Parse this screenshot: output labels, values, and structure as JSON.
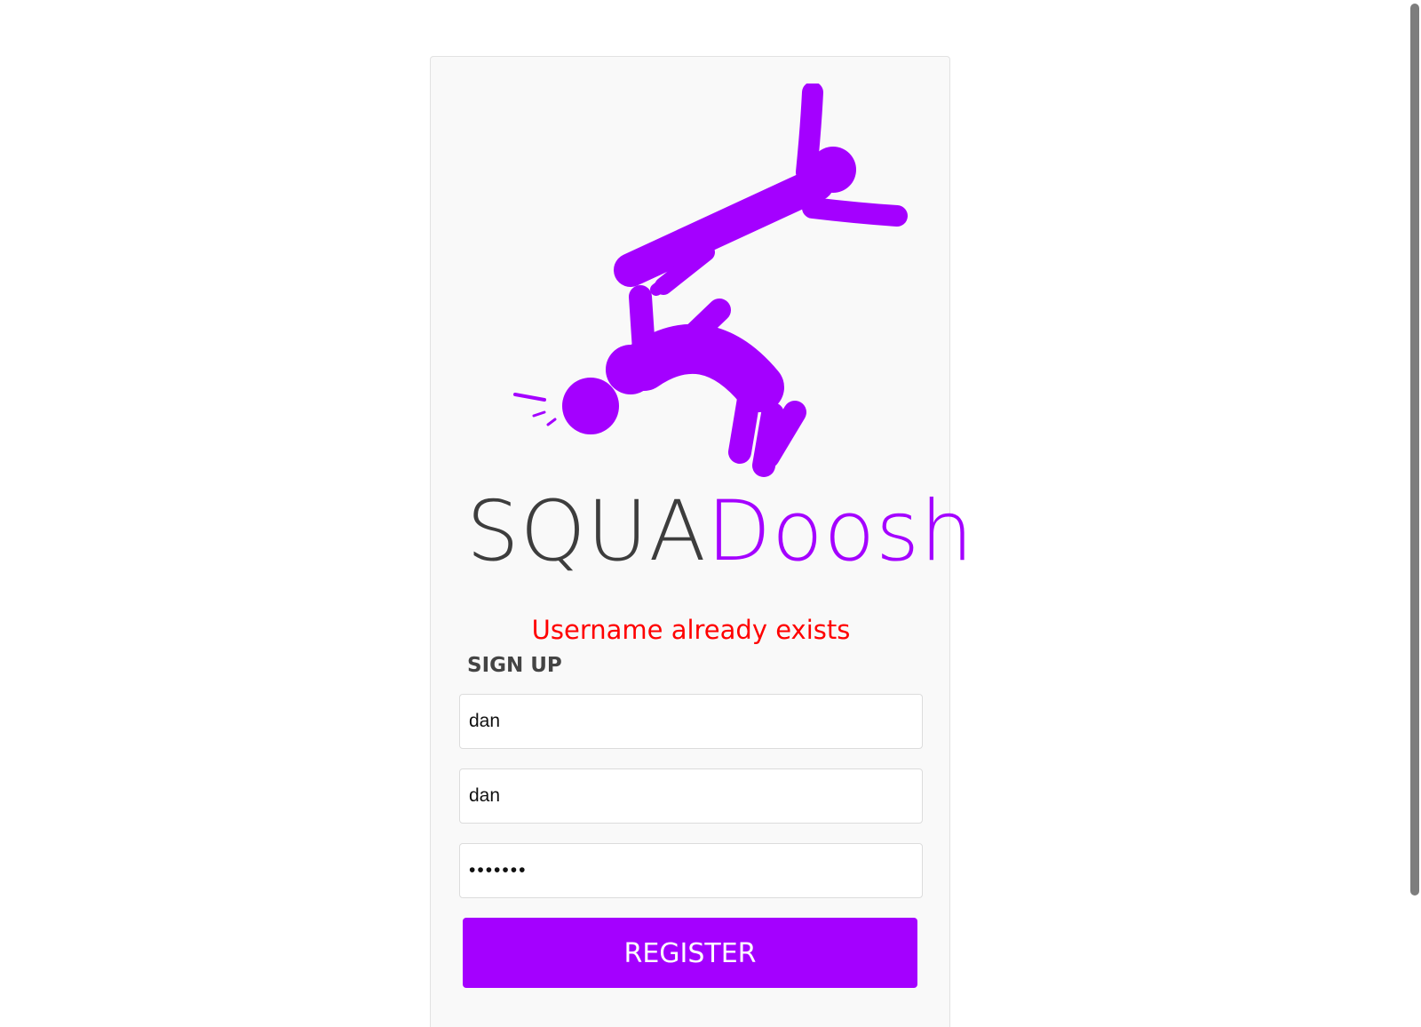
{
  "logo": {
    "name_part1": "SQUA",
    "name_part2": "Doosh",
    "brand_color": "#a400ff",
    "text_color": "#3d3d3d"
  },
  "signup": {
    "error_message": "Username already exists",
    "error_color": "#ff0000",
    "title": "SIGN UP",
    "field1_value": "dan",
    "field2_value": "dan",
    "password_value": "•••••••",
    "register_label": "REGISTER"
  }
}
